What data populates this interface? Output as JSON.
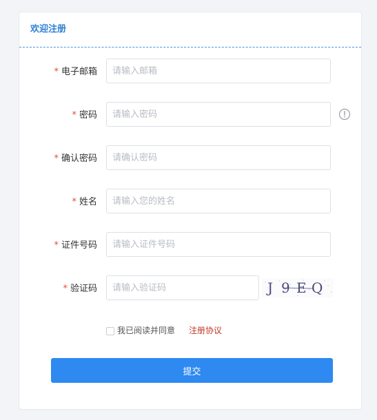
{
  "card": {
    "title": "欢迎注册"
  },
  "fields": {
    "email": {
      "label": "电子邮箱",
      "placeholder": "请输入邮箱",
      "value": ""
    },
    "password": {
      "label": "密码",
      "placeholder": "请输入密码",
      "value": ""
    },
    "confirm_password": {
      "label": "确认密码",
      "placeholder": "请确认密码",
      "value": ""
    },
    "name": {
      "label": "姓名",
      "placeholder": "请输入您的姓名",
      "value": ""
    },
    "id_number": {
      "label": "证件号码",
      "placeholder": "请输入证件号码",
      "value": ""
    },
    "captcha": {
      "label": "验证码",
      "placeholder": "请输入验证码",
      "value": ""
    }
  },
  "required_mark": "*",
  "captcha_image": {
    "chars": [
      "J",
      "9",
      "E",
      "Q"
    ]
  },
  "agreement": {
    "text": "我已阅读并同意",
    "link": "注册协议",
    "checked": false
  },
  "submit_label": "提交",
  "colors": {
    "accent": "#2e89f0",
    "title": "#2f80d1",
    "required": "#e0502f",
    "link": "#c0392b"
  },
  "icons": {
    "password_hint": "info-circle-icon"
  }
}
